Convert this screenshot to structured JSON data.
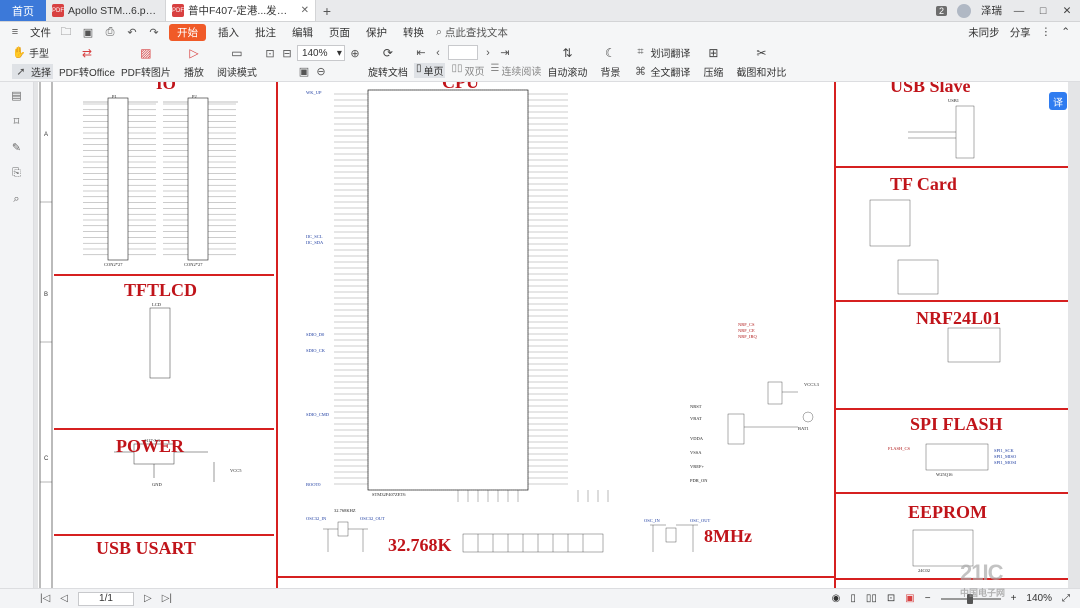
{
  "tabs": {
    "home": "首页",
    "items": [
      {
        "label": "Apollo STM...6.pdf (已加密)",
        "active": false
      },
      {
        "label": "普中F407-定港...发板原理图.pdf",
        "active": true
      }
    ]
  },
  "titlebar": {
    "badge": "2",
    "user": "泽瑞"
  },
  "toolbar1": {
    "file": "文件",
    "start": "开始",
    "menus": [
      "插入",
      "批注",
      "编辑",
      "页面",
      "保护",
      "转换"
    ],
    "search": "点此查找文本",
    "sync": "未同步",
    "share": "分享"
  },
  "toolbar2": {
    "hand": "手型",
    "select": "选择",
    "to_office": "PDF转Office",
    "to_image": "PDF转图片",
    "play": "播放",
    "read_mode": "阅读模式",
    "zoom": "140%",
    "rotate": "旋转文档",
    "single": "单页",
    "double": "双页",
    "continuous": "连续阅读",
    "auto_scroll": "自动滚动",
    "background": "背景",
    "translate_word": "划词翻译",
    "translate_full": "全文翻译",
    "compress": "压缩",
    "screenshot": "截图和对比"
  },
  "schematic": {
    "blocks": {
      "io": "IO",
      "cpu": "CPU",
      "tftlcd": "TFTLCD",
      "power": "POWER",
      "usb_usart": "USB USART",
      "crystal_32k": "32.768K",
      "crystal_8m": "8MHz",
      "usb_slave": "USB Slave",
      "tf_card": "TF Card",
      "nrf": "NRF24L01",
      "spi_flash": "SPI FLASH",
      "eeprom": "EEPROM"
    },
    "row_letters": [
      "A",
      "B",
      "C"
    ],
    "labels": {
      "p1": "P1",
      "p2": "P2",
      "conn1": "CON2*27",
      "conn2": "CON2*27",
      "lcd": "LCD",
      "ams": "1117-3.3",
      "u1": "STM32F407ZET6",
      "wk_up": "WK_UP",
      "boot0": "BOOT0",
      "osc32_in": "OSC32_IN",
      "osc32_out": "OSC32_OUT",
      "crystal_32k_part": "32.768KHZ",
      "osc_in": "OSC_IN",
      "osc_out": "OSC_OUT",
      "nrst": "NRST",
      "vbat": "VBAT",
      "vdda": "VDDA",
      "vssa": "VSSA",
      "vref": "VREF+",
      "pdr_on": "PDR_ON",
      "gnd": "GND",
      "vcc33": "VCC3.3",
      "vcc5": "VCC5",
      "usb1": "USB1",
      "w25q16": "W25Q16",
      "24c02": "24C02",
      "bat": "BAT1",
      "spi_clk": "SPI1_SCK",
      "spi_miso": "SPI1_MISO",
      "spi_mosi": "SPI1_MOSI",
      "flash_cs": "FLASH_CS",
      "nrf_cs": "NRF_CS",
      "nrf_ce": "NRF_CE",
      "nrf_irq": "NRF_IRQ",
      "iic_scl": "IIC_SCL",
      "iic_sda": "IIC_SDA",
      "sdio_d0": "SDIO_D0",
      "sdio_ck": "SDIO_CK",
      "sdio_cmd": "SDIO_CMD"
    }
  },
  "statusbar": {
    "page": "1/1",
    "zoom": "140%"
  },
  "watermark": {
    "main": "21IC",
    "sub": "中国电子网"
  },
  "float_btn": "译"
}
